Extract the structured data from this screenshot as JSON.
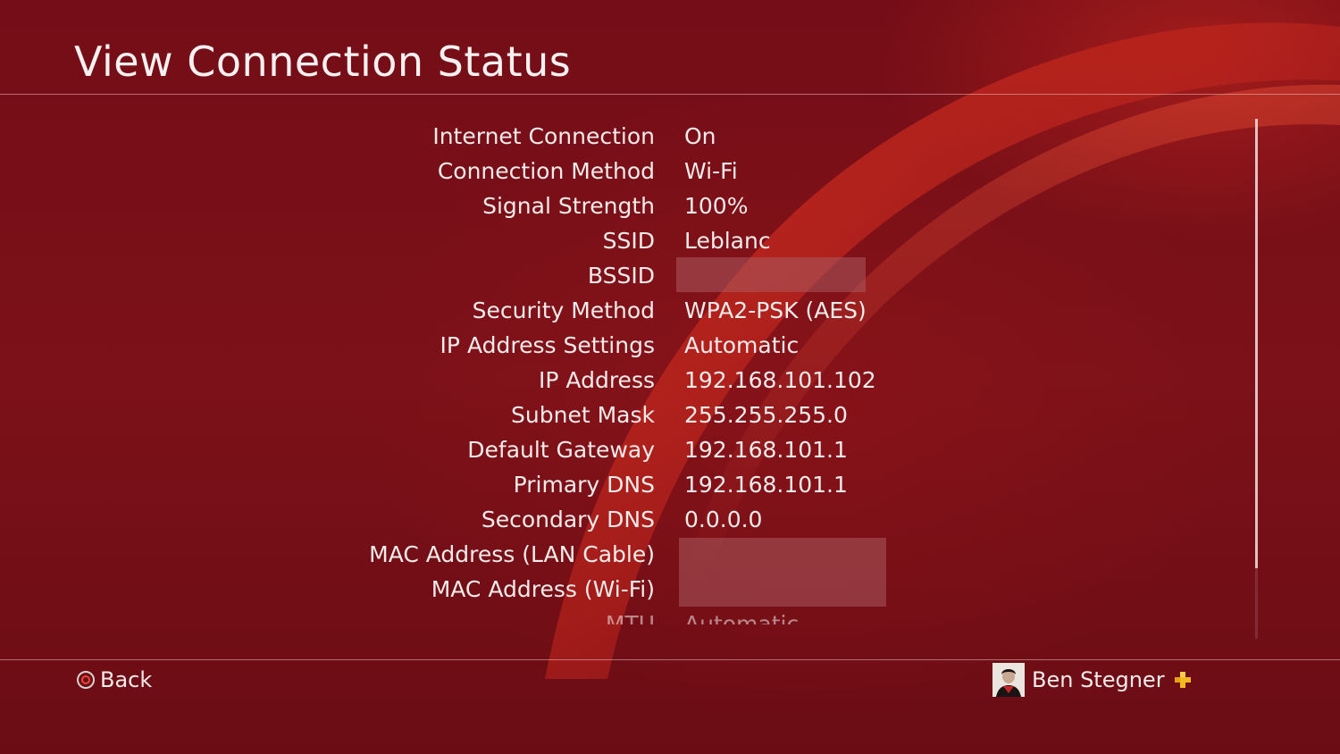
{
  "header": {
    "title": "View Connection Status"
  },
  "rows": [
    {
      "label": "Internet Connection",
      "value": "On"
    },
    {
      "label": "Connection Method",
      "value": "Wi-Fi"
    },
    {
      "label": "Signal Strength",
      "value": "100%"
    },
    {
      "label": "SSID",
      "value": "Leblanc"
    },
    {
      "label": "BSSID",
      "value": ""
    },
    {
      "label": "Security Method",
      "value": "WPA2-PSK (AES)"
    },
    {
      "label": "IP Address Settings",
      "value": "Automatic"
    },
    {
      "label": "IP Address",
      "value": "192.168.101.102"
    },
    {
      "label": "Subnet Mask",
      "value": "255.255.255.0"
    },
    {
      "label": "Default Gateway",
      "value": "192.168.101.1"
    },
    {
      "label": "Primary DNS",
      "value": "192.168.101.1"
    },
    {
      "label": "Secondary DNS",
      "value": "0.0.0.0"
    },
    {
      "label": "MAC Address (LAN Cable)",
      "value": ""
    },
    {
      "label": "MAC Address (Wi-Fi)",
      "value": ""
    },
    {
      "label": "MTU",
      "value": "Automatic"
    }
  ],
  "footer": {
    "back_label": "Back",
    "back_icon": "circle-button-icon",
    "user_name": "Ben Stegner",
    "plus_icon": "playstation-plus-icon"
  },
  "colors": {
    "background": "#740d17",
    "accent_swoosh": "#c8281e",
    "text": "#f3eaea",
    "plus_gold": "#f2b81e"
  }
}
